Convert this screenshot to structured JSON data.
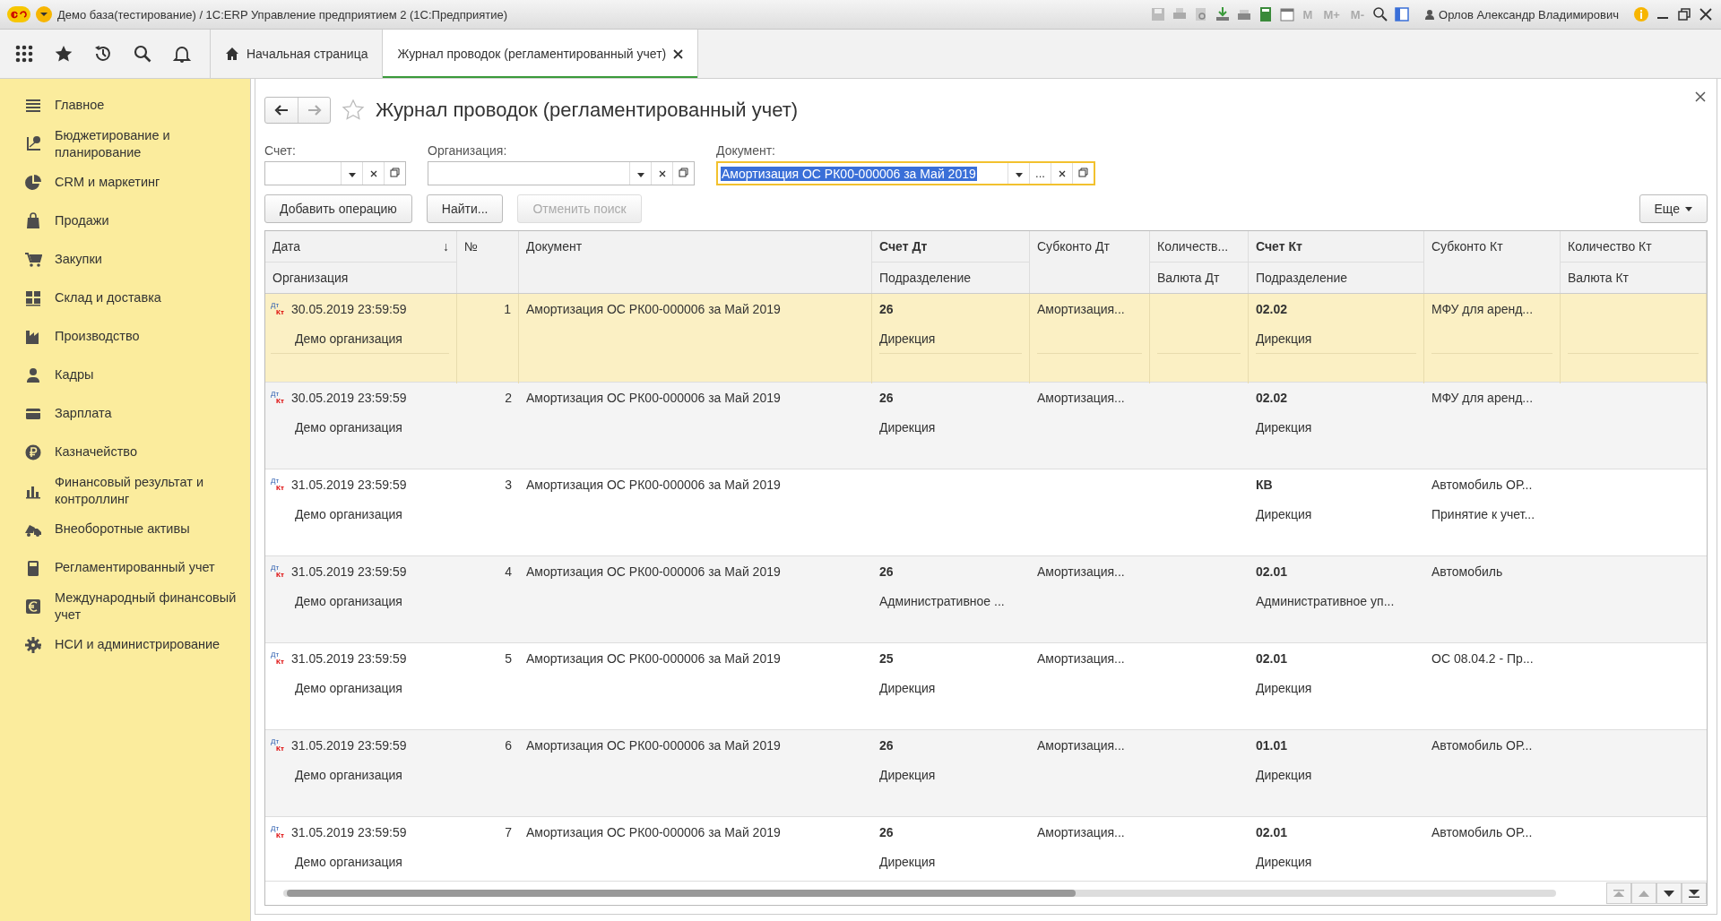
{
  "window": {
    "title": "Демо база(тестирование) / 1С:ERP Управление предприятием 2  (1С:Предприятие)",
    "memory_buttons": [
      "M",
      "M+",
      "M-"
    ],
    "user": "Орлов Александр Владимирович"
  },
  "tabs": [
    {
      "label": "Начальная страница",
      "kind": "home",
      "selected": false
    },
    {
      "label": "Журнал проводок (регламентированный учет)",
      "kind": "page",
      "selected": true
    }
  ],
  "sidebar": {
    "items": [
      {
        "label": "Главное"
      },
      {
        "label": "Бюджетирование и планирование"
      },
      {
        "label": "CRM и маркетинг"
      },
      {
        "label": "Продажи"
      },
      {
        "label": "Закупки"
      },
      {
        "label": "Склад и доставка"
      },
      {
        "label": "Производство"
      },
      {
        "label": "Кадры"
      },
      {
        "label": "Зарплата"
      },
      {
        "label": "Казначейство"
      },
      {
        "label": "Финансовый результат и контроллинг"
      },
      {
        "label": "Внеоборотные активы"
      },
      {
        "label": "Регламентированный учет"
      },
      {
        "label": "Международный финансовый учет"
      },
      {
        "label": "НСИ и администрирование"
      }
    ]
  },
  "form": {
    "title": "Журнал проводок (регламентированный учет)",
    "filters": [
      {
        "label": "Счет:",
        "focused": false
      },
      {
        "label": "Организация:",
        "focused": false
      },
      {
        "label": "Документ:",
        "value": "Амортизация ОС РК00-000006 за Май 2019",
        "focused": true,
        "choose_button": "..."
      }
    ],
    "buttons": [
      {
        "label": "Добавить операцию",
        "disabled": false
      },
      {
        "label": "Найти...",
        "disabled": false
      },
      {
        "label": "Отменить поиск",
        "disabled": true
      }
    ],
    "more_button": "Еще"
  },
  "table": {
    "columns": [
      {
        "title": "Дата",
        "subtitle": "Организация",
        "sort_mark": "↓",
        "bold": false
      },
      {
        "title": "№",
        "bold": false
      },
      {
        "title": "Документ",
        "bold": false
      },
      {
        "title": "Счет Дт",
        "subtitle": "Подразделение",
        "bold": true
      },
      {
        "title": "Субконто Дт",
        "bold": false
      },
      {
        "title": "Количеств...",
        "subtitle": "Валюта Дт",
        "bold": false
      },
      {
        "title": "Счет Кт",
        "subtitle": "Подразделение",
        "bold": true
      },
      {
        "title": "Субконто Кт",
        "bold": false
      },
      {
        "title": "Количество Кт",
        "subtitle": "Валюта Кт",
        "bold": false
      }
    ],
    "rows": [
      {
        "selected": true,
        "badge_top": "Дт",
        "badge_bottom": "Кт",
        "date": "30.05.2019 23:59:59",
        "organization": "Демо организация",
        "number": "1",
        "document": "Амортизация ОС РК00-000006 за Май 2019",
        "account_dt": "26",
        "subdivision_dt": "Дирекция",
        "subconto_dt": [
          "Амортизация..."
        ],
        "account_kt": "02.02",
        "subdivision_kt": "Дирекция",
        "subconto_kt": [
          "МФУ для аренд..."
        ]
      },
      {
        "selected": false,
        "badge_top": "Дт",
        "badge_bottom": "Кт",
        "date": "30.05.2019 23:59:59",
        "organization": "Демо организация",
        "number": "2",
        "document": "Амортизация ОС РК00-000006 за Май 2019",
        "account_dt": "26",
        "subdivision_dt": "Дирекция",
        "subconto_dt": [
          "Амортизация..."
        ],
        "account_kt": "02.02",
        "subdivision_kt": "Дирекция",
        "subconto_kt": [
          "МФУ для аренд..."
        ]
      },
      {
        "selected": false,
        "badge_top": "Дт",
        "badge_bottom": "Кт",
        "date": "31.05.2019 23:59:59",
        "organization": "Демо организация",
        "number": "3",
        "document": "Амортизация ОС РК00-000006 за Май 2019",
        "account_kt": "КВ",
        "subdivision_kt": "Дирекция",
        "subconto_kt": [
          "Автомобиль ОР...",
          "Принятие к учет..."
        ]
      },
      {
        "selected": false,
        "badge_top": "Дт",
        "badge_bottom": "Кт",
        "date": "31.05.2019 23:59:59",
        "organization": "Демо организация",
        "number": "4",
        "document": "Амортизация ОС РК00-000006 за Май 2019",
        "account_dt": "26",
        "subdivision_dt": "Административное ...",
        "subconto_dt": [
          "Амортизация..."
        ],
        "account_kt": "02.01",
        "subdivision_kt": "Административное уп...",
        "subconto_kt": [
          "Автомобиль"
        ]
      },
      {
        "selected": false,
        "badge_top": "Дт",
        "badge_bottom": "Кт",
        "date": "31.05.2019 23:59:59",
        "organization": "Демо организация",
        "number": "5",
        "document": "Амортизация ОС РК00-000006 за Май 2019",
        "account_dt": "25",
        "subdivision_dt": "Дирекция",
        "subconto_dt": [
          "Амортизация..."
        ],
        "account_kt": "02.01",
        "subdivision_kt": "Дирекция",
        "subconto_kt": [
          "ОС 08.04.2 - Пр..."
        ]
      },
      {
        "selected": false,
        "badge_top": "Дт",
        "badge_bottom": "Кт",
        "date": "31.05.2019 23:59:59",
        "organization": "Демо организация",
        "number": "6",
        "document": "Амортизация ОС РК00-000006 за Май 2019",
        "account_dt": "26",
        "subdivision_dt": "Дирекция",
        "subconto_dt": [
          "Амортизация..."
        ],
        "account_kt": "01.01",
        "subdivision_kt": "Дирекция",
        "subconto_kt": [
          "Автомобиль ОР..."
        ]
      },
      {
        "selected": false,
        "badge_top": "Дт",
        "badge_bottom": "Кт",
        "date": "31.05.2019 23:59:59",
        "organization": "Демо организация",
        "number": "7",
        "document": "Амортизация ОС РК00-000006 за Май 2019",
        "account_dt": "26",
        "subdivision_dt": "Дирекция",
        "subconto_dt": [
          "Амортизация..."
        ],
        "account_kt": "02.01",
        "subdivision_kt": "Дирекция",
        "subconto_kt": [
          "Автомобиль ОР..."
        ]
      }
    ]
  }
}
